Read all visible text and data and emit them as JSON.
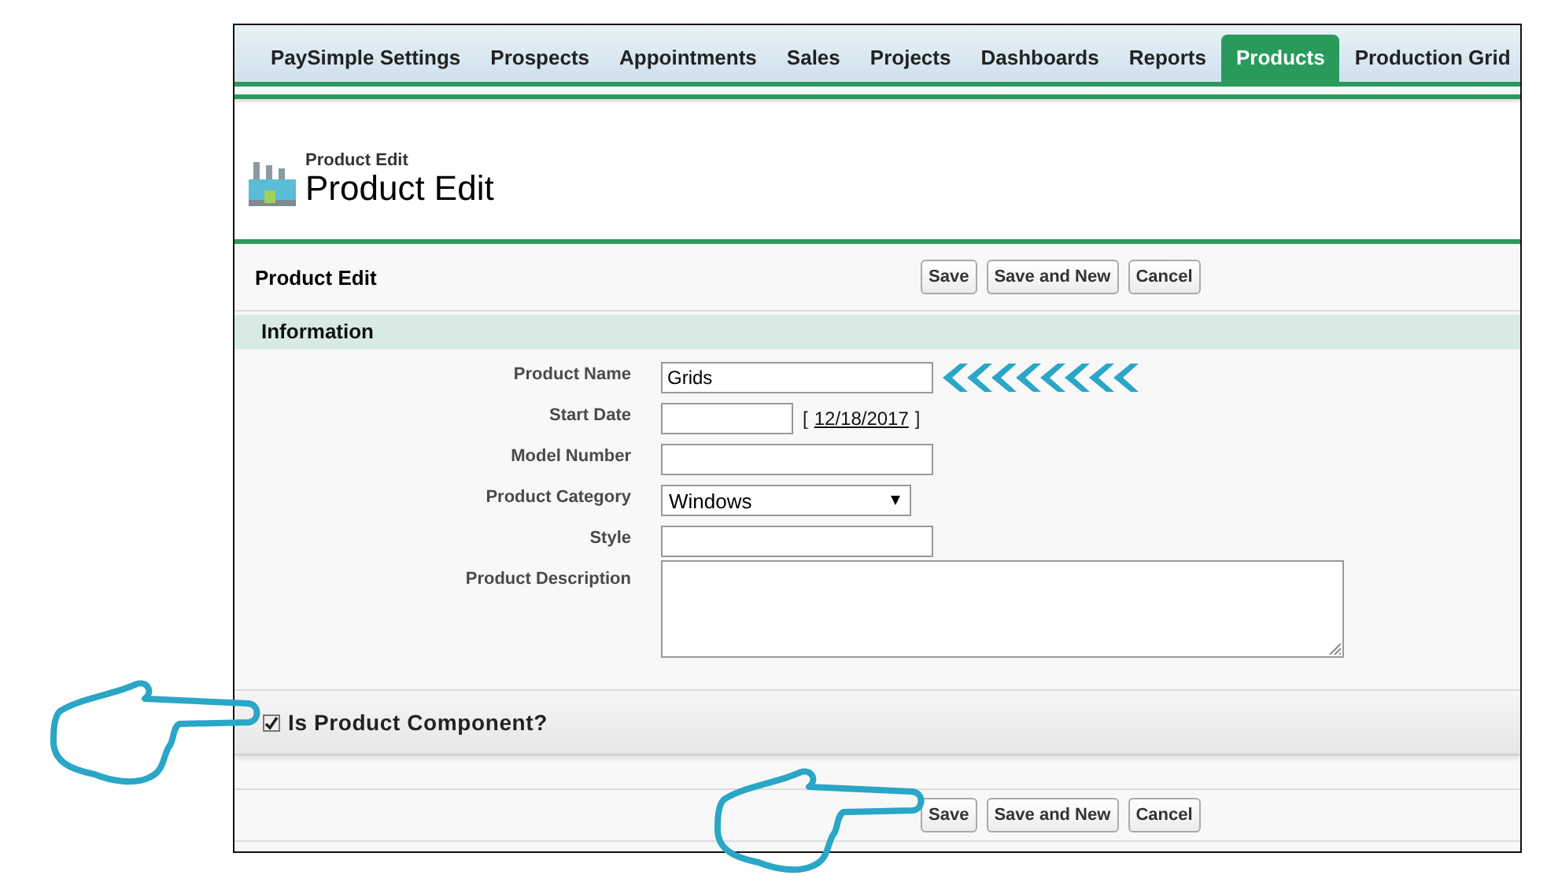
{
  "tabs": [
    {
      "label": "PaySimple Settings",
      "selected": false
    },
    {
      "label": "Prospects",
      "selected": false
    },
    {
      "label": "Appointments",
      "selected": false
    },
    {
      "label": "Sales",
      "selected": false
    },
    {
      "label": "Projects",
      "selected": false
    },
    {
      "label": "Dashboards",
      "selected": false
    },
    {
      "label": "Reports",
      "selected": false
    },
    {
      "label": "Products",
      "selected": true
    },
    {
      "label": "Production Grid",
      "selected": false
    }
  ],
  "page_header": {
    "breadcrumb": "Product Edit",
    "title": "Product Edit"
  },
  "edit_block": {
    "title": "Product Edit",
    "top_buttons": [
      "Save",
      "Save and New",
      "Cancel"
    ]
  },
  "section": {
    "title": "Information"
  },
  "fields": [
    {
      "kind": "text",
      "label": "Product Name",
      "value": "Grids",
      "highlighted": true
    },
    {
      "kind": "date",
      "label": "Start Date",
      "date_prefix": "[",
      "date_link": "12/18/2017",
      "date_suffix": "]"
    },
    {
      "kind": "text",
      "label": "Model Number"
    },
    {
      "kind": "select",
      "label": "Product Category",
      "value": "Windows"
    },
    {
      "kind": "text",
      "label": "Style"
    },
    {
      "kind": "textarea",
      "label": "Product Description"
    }
  ],
  "component_checkbox": {
    "label": "Is Product Component?",
    "checked": true
  },
  "bottom_buttons": [
    "Save",
    "Save and New",
    "Cancel"
  ]
}
